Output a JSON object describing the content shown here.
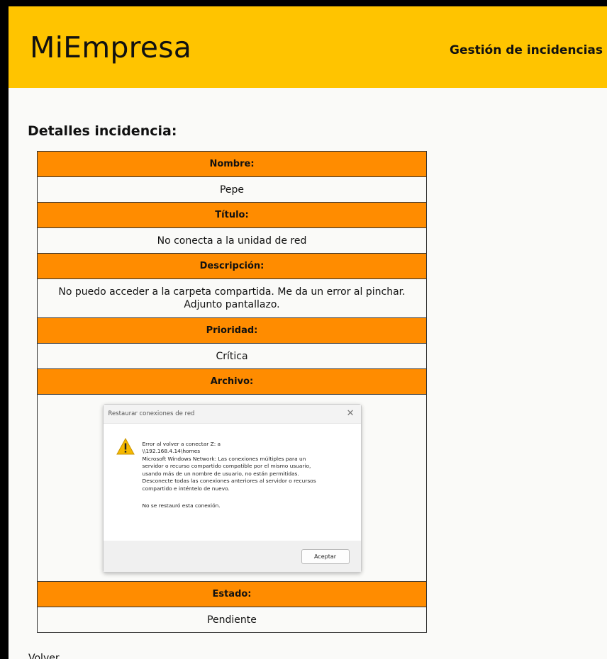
{
  "header": {
    "logo": "MiEmpresa",
    "nav_title": "Gestión de incidencias"
  },
  "page": {
    "section_title": "Detalles incidencia:",
    "back_label": "Volver"
  },
  "details": {
    "nombre_label": "Nombre:",
    "nombre_value": "Pepe",
    "titulo_label": "Título:",
    "titulo_value": "No conecta a la unidad de red",
    "descripcion_label": "Descripción:",
    "descripcion_line1": "No puedo acceder a la carpeta compartida. Me da un error al pinchar.",
    "descripcion_line2": "Adjunto pantallazo.",
    "prioridad_label": "Prioridad:",
    "prioridad_value": "Crítica",
    "archivo_label": "Archivo:",
    "estado_label": "Estado:",
    "estado_value": "Pendiente"
  },
  "attachment_dialog": {
    "title": "Restaurar conexiones de red",
    "close_glyph": "✕",
    "lines": [
      "Error al volver a conectar Z: a",
      "\\\\192.168.4.14\\homes",
      "Microsoft Windows Network: Las conexiones múltiples para un",
      "servidor o recurso compartido compatible por el mismo usuario,",
      "usando más de un nombre de usuario, no están permitidas.",
      "Desconecte todas las conexiones anteriores al servidor o recursos",
      "compartido e inténtelo de nuevo."
    ],
    "footer_line": "No se restauró esta conexión.",
    "button_label": "Aceptar",
    "icon": "warning-icon"
  },
  "colors": {
    "header_bg": "#ffc400",
    "label_bg": "#ff8c00",
    "page_bg": "#fafaf8"
  }
}
